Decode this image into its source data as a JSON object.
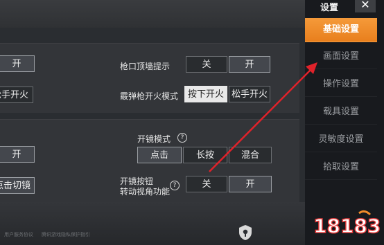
{
  "sidebar": {
    "title": "设置",
    "close": "✕",
    "items": [
      {
        "label": "基础设置",
        "active": true
      },
      {
        "label": "画面设置",
        "active": false
      },
      {
        "label": "操作设置",
        "active": false
      },
      {
        "label": "载具设置",
        "active": false
      },
      {
        "label": "灵敏度设置",
        "active": false
      },
      {
        "label": "拾取设置",
        "active": false
      }
    ]
  },
  "settings": {
    "left_on_1": "开",
    "left_release_fire": "松手开火",
    "muzzle_hint": {
      "label": "枪口顶墙提示",
      "off": "关",
      "on": "开",
      "selected": "on"
    },
    "shotgun_fire": {
      "label": "霰弹枪开火模式",
      "press": "按下开火",
      "release": "松手开火",
      "selected": "press"
    },
    "scope_mode": {
      "label": "开镜模式",
      "tap": "点击",
      "hold": "长按",
      "mixed": "混合",
      "selected": "tap"
    },
    "left_on_2": "开",
    "left_tap_switch": "点击切镜",
    "scope_button_view": {
      "label_line1": "开镜按钮",
      "label_line2": "转动视角功能",
      "off": "关",
      "on": "开",
      "selected": "on"
    },
    "help_mark": "?"
  },
  "footer": {
    "link1": "用户服务协议",
    "link2": "腾讯游戏隐私保护指引"
  },
  "watermark": {
    "text": "18183"
  },
  "colors": {
    "accent": "#f0892a",
    "arrow": "#e0222a"
  }
}
